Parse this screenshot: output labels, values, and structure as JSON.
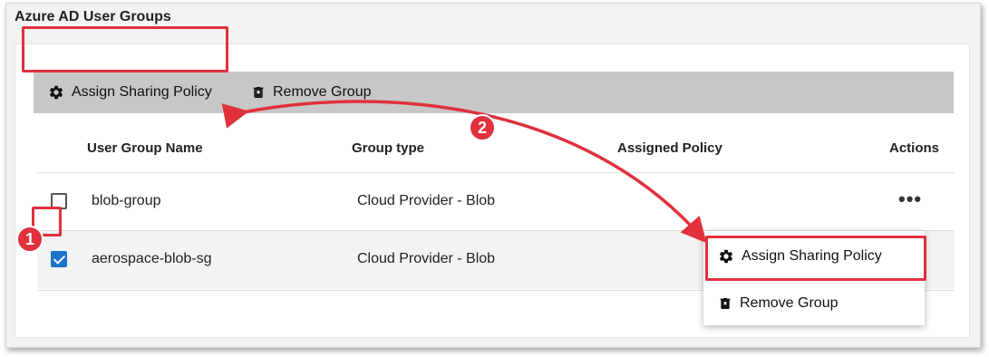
{
  "panel": {
    "title": "Azure AD User Groups"
  },
  "toolbar": {
    "assign_label": "Assign Sharing Policy",
    "remove_label": "Remove Group"
  },
  "table": {
    "columns": [
      "User Group Name",
      "Group type",
      "Assigned Policy",
      "Actions"
    ],
    "rows": [
      {
        "name": "blob-group",
        "type": "Cloud Provider - Blob",
        "policy": "",
        "checked": false,
        "actions": "•••"
      },
      {
        "name": "aerospace-blob-sg",
        "type": "Cloud Provider - Blob",
        "policy": "",
        "checked": true
      }
    ]
  },
  "context_menu": {
    "items": [
      {
        "label": "Assign Sharing Policy",
        "icon": "gear-icon"
      },
      {
        "label": "Remove Group",
        "icon": "trash-icon"
      }
    ]
  },
  "annotations": {
    "step1": "1",
    "step2": "2",
    "highlight_color": "#e0313d"
  },
  "colors": {
    "checkbox_checked": "#1a73c8",
    "toolbar_bg": "#c7c7c7"
  }
}
